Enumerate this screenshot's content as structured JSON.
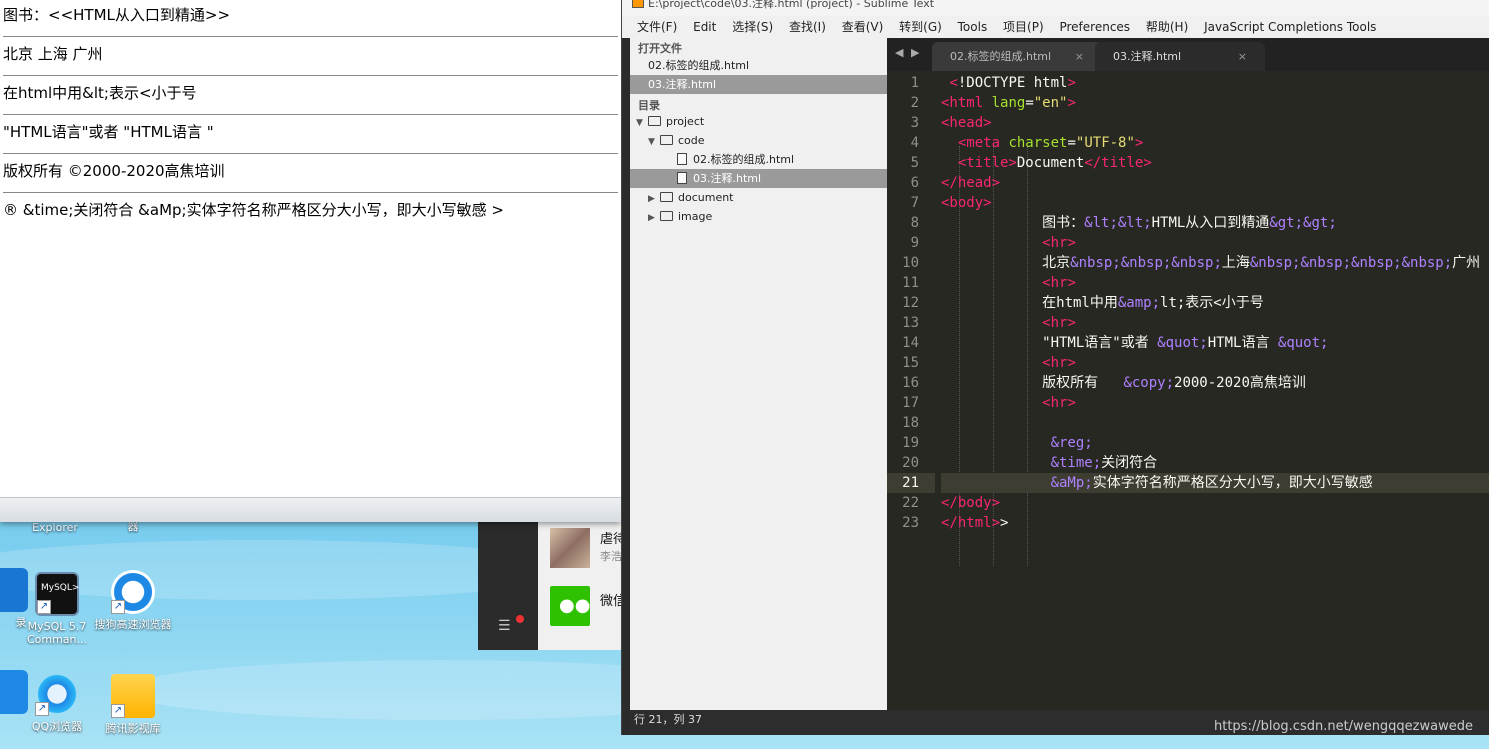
{
  "browser": {
    "lines": [
      "图书：<<HTML从入口到精通>>",
      "北京    上海     广州",
      "在html中用&lt;表示<小于号",
      "\"HTML语言\"或者 \"HTML语言 \"",
      "版权所有  ©2000-2020高焦培训",
      "® &time;关闭符合 &aMp;实体字符名称严格区分大小写，即大小写敏感 >"
    ]
  },
  "desktop": {
    "icons": [
      {
        "label": "Internet Explorer"
      },
      {
        "label": "器"
      },
      {
        "label": "MySQL 5.7 Comman..."
      },
      {
        "label": "搜狗高速浏览器"
      },
      {
        "label": "QQ浏览器"
      },
      {
        "label": "腾讯影视库"
      },
      {
        "label": "录"
      }
    ],
    "mysql_glyph_text": "MySQL>"
  },
  "notification": {
    "item1_title": "虐待",
    "item1_sub": "李浩",
    "item2_title": "微信"
  },
  "sublime": {
    "title": "E:\\project\\code\\03.注释.html (project) - Sublime Text",
    "menu": [
      "文件(F)",
      "Edit",
      "选择(S)",
      "查找(I)",
      "查看(V)",
      "转到(G)",
      "Tools",
      "项目(P)",
      "Preferences",
      "帮助(H)",
      "JavaScript Completions Tools"
    ],
    "sidebar": {
      "open_files_header": "打开文件",
      "open_files": [
        "02.标签的组成.html",
        "03.注释.html"
      ],
      "folders_header": "目录",
      "tree": {
        "project": "project",
        "code": "code",
        "file1": "02.标签的组成.html",
        "file2": "03.注释.html",
        "document": "document",
        "image": "image"
      }
    },
    "tabs": [
      "02.标签的组成.html",
      "03.注释.html"
    ],
    "tab_close": "×",
    "status": "行 21，列 37",
    "current_line": 21
  },
  "watermark": "https://blog.csdn.net/wengqqezwawede"
}
